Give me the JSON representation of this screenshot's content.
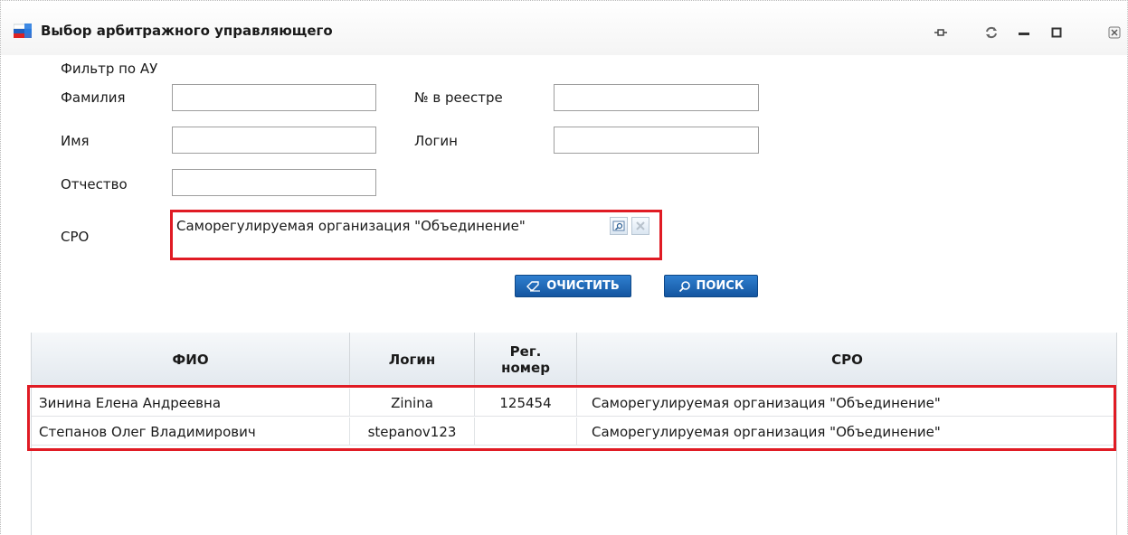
{
  "window": {
    "title": "Выбор арбитражного управляющего"
  },
  "filter": {
    "section_title": "Фильтр по АУ",
    "lastname_label": "Фамилия",
    "lastname_value": "",
    "firstname_label": "Имя",
    "firstname_value": "",
    "middlename_label": "Отчество",
    "middlename_value": "",
    "registry_label": "№ в реестре",
    "registry_value": "",
    "login_label": "Логин",
    "login_value": "",
    "sro_label": "СРО",
    "sro_value": "Саморегулируемая организация \"Объединение\""
  },
  "buttons": {
    "clear_label": "ОЧИСТИТЬ",
    "search_label": "ПОИСК"
  },
  "table": {
    "columns": [
      "ФИО",
      "Логин",
      "Рег. номер",
      "СРО"
    ],
    "rows": [
      {
        "fio": "Зинина Елена Андреевна",
        "login": "Zinina",
        "reg": "125454",
        "sro": "Саморегулируемая организация \"Объединение\""
      },
      {
        "fio": "Степанов Олег Владимирович",
        "login": "stepanov123",
        "reg": "",
        "sro": "Саморегулируемая организация \"Объединение\""
      }
    ]
  },
  "colors": {
    "highlight": "#e01b24",
    "button": "#1a63b0"
  },
  "icons": {
    "app": "app-flag-icon",
    "pin": "pin-icon",
    "refresh": "refresh-icon",
    "minimize": "minimize-icon",
    "maximize": "maximize-icon",
    "close": "close-icon",
    "lookup": "lookup-icon",
    "clear_field": "clear-field-icon",
    "eraser": "eraser-icon",
    "search": "search-icon"
  }
}
